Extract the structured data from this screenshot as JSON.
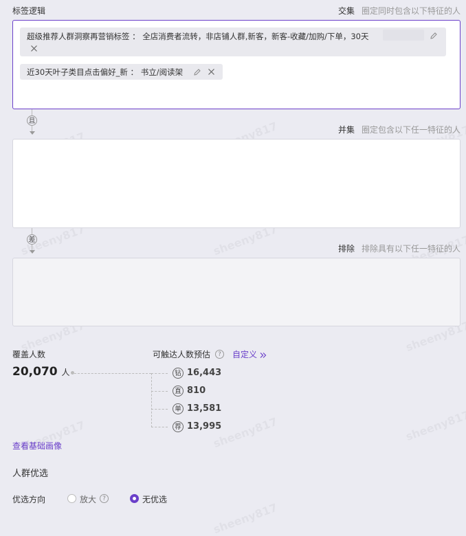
{
  "logic_section": {
    "title": "标签逻辑"
  },
  "intersection": {
    "label": "交集",
    "hint": "圈定同时包含以下特征的人",
    "tags": [
      {
        "text": "超级推荐人群洞察再营销标签 ： 全店消费者流转，非店铺人群,新客，新客-收藏/加购/下单，30天"
      },
      {
        "text": "近30天叶子类目点击偏好_新 ： 书立/阅读架"
      }
    ]
  },
  "connector_and": {
    "label": "且"
  },
  "union": {
    "label": "并集",
    "hint": "圈定包含以下任一特征的人"
  },
  "connector_diff": {
    "label": "差"
  },
  "exclude": {
    "label": "排除",
    "hint": "排除具有以下任一特征的人"
  },
  "coverage": {
    "label": "覆盖人数",
    "value": "20,070",
    "unit": "人"
  },
  "reach": {
    "label": "可触达人数预估",
    "help": "?",
    "custom_link": "自定义",
    "custom_icon": "double-chevron-right-icon",
    "channels": [
      {
        "badge": "钻",
        "value": "16,443"
      },
      {
        "badge": "直",
        "value": "810"
      },
      {
        "badge": "单",
        "value": "13,581"
      },
      {
        "badge": "荐",
        "value": "13,995"
      }
    ]
  },
  "view_profile_link": "查看基础画像",
  "optimization": {
    "title": "人群优选",
    "direction_label": "优选方向",
    "options": [
      {
        "label": "放大",
        "selected": false,
        "help": "?"
      },
      {
        "label": "无优选",
        "selected": true
      }
    ]
  },
  "colors": {
    "accent": "#6a3fc9",
    "background": "#ebebf2",
    "border": "#d6d6de"
  },
  "watermark_text": "sheeny817"
}
